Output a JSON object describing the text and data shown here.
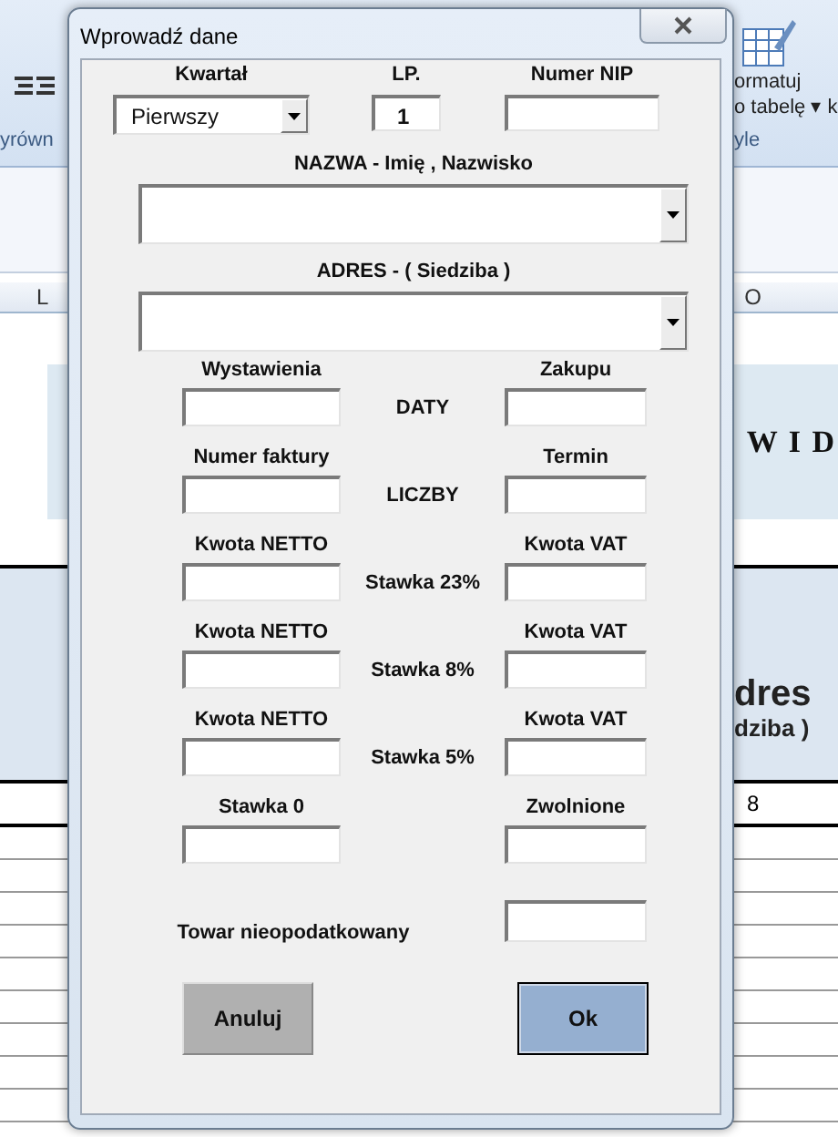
{
  "excel": {
    "ribbon_left_group": "yrówn",
    "ribbon_button_lines": [
      "ormatuj",
      "o tabelę ▾ k"
    ],
    "ribbon_right_group": "yle",
    "column_headers": [
      "L",
      "O"
    ],
    "sheet_title": "W I D",
    "table_header_lines": [
      "dres",
      "dziba )"
    ],
    "column_number": "8"
  },
  "dialog": {
    "title": "Wprowadź dane",
    "top_fields": [
      {
        "kind": "dropdown",
        "label": "Kwartał",
        "value": "Pierwszy"
      },
      {
        "kind": "input",
        "label": "LP.",
        "value": "1"
      },
      {
        "kind": "input",
        "label": "Numer  NIP"
      }
    ],
    "combos": [
      {
        "label": "NAZWA  -  Imię , Nazwisko"
      },
      {
        "label": "ADRES  -  ( Siedziba )"
      }
    ],
    "pairs": [
      {
        "left_label": "Wystawienia",
        "middle": "DATY",
        "right_label": "Zakupu"
      },
      {
        "left_label": "Numer faktury",
        "middle": "LICZBY",
        "right_label": "Termin"
      },
      {
        "left_label": "Kwota NETTO",
        "middle": "Stawka 23%",
        "right_label": "Kwota VAT"
      },
      {
        "left_label": "Kwota NETTO",
        "middle": "Stawka 8%",
        "right_label": "Kwota VAT"
      },
      {
        "left_label": "Kwota NETTO",
        "middle": "Stawka 5%",
        "right_label": "Kwota VAT"
      },
      {
        "left_label": "Stawka 0",
        "right_label": "Zwolnione"
      }
    ],
    "extra_field": {
      "label": "Towar nieopodatkowany"
    },
    "buttons": [
      {
        "kind": "cancel",
        "label": "Anuluj"
      },
      {
        "kind": "default",
        "label": "Ok"
      }
    ]
  }
}
